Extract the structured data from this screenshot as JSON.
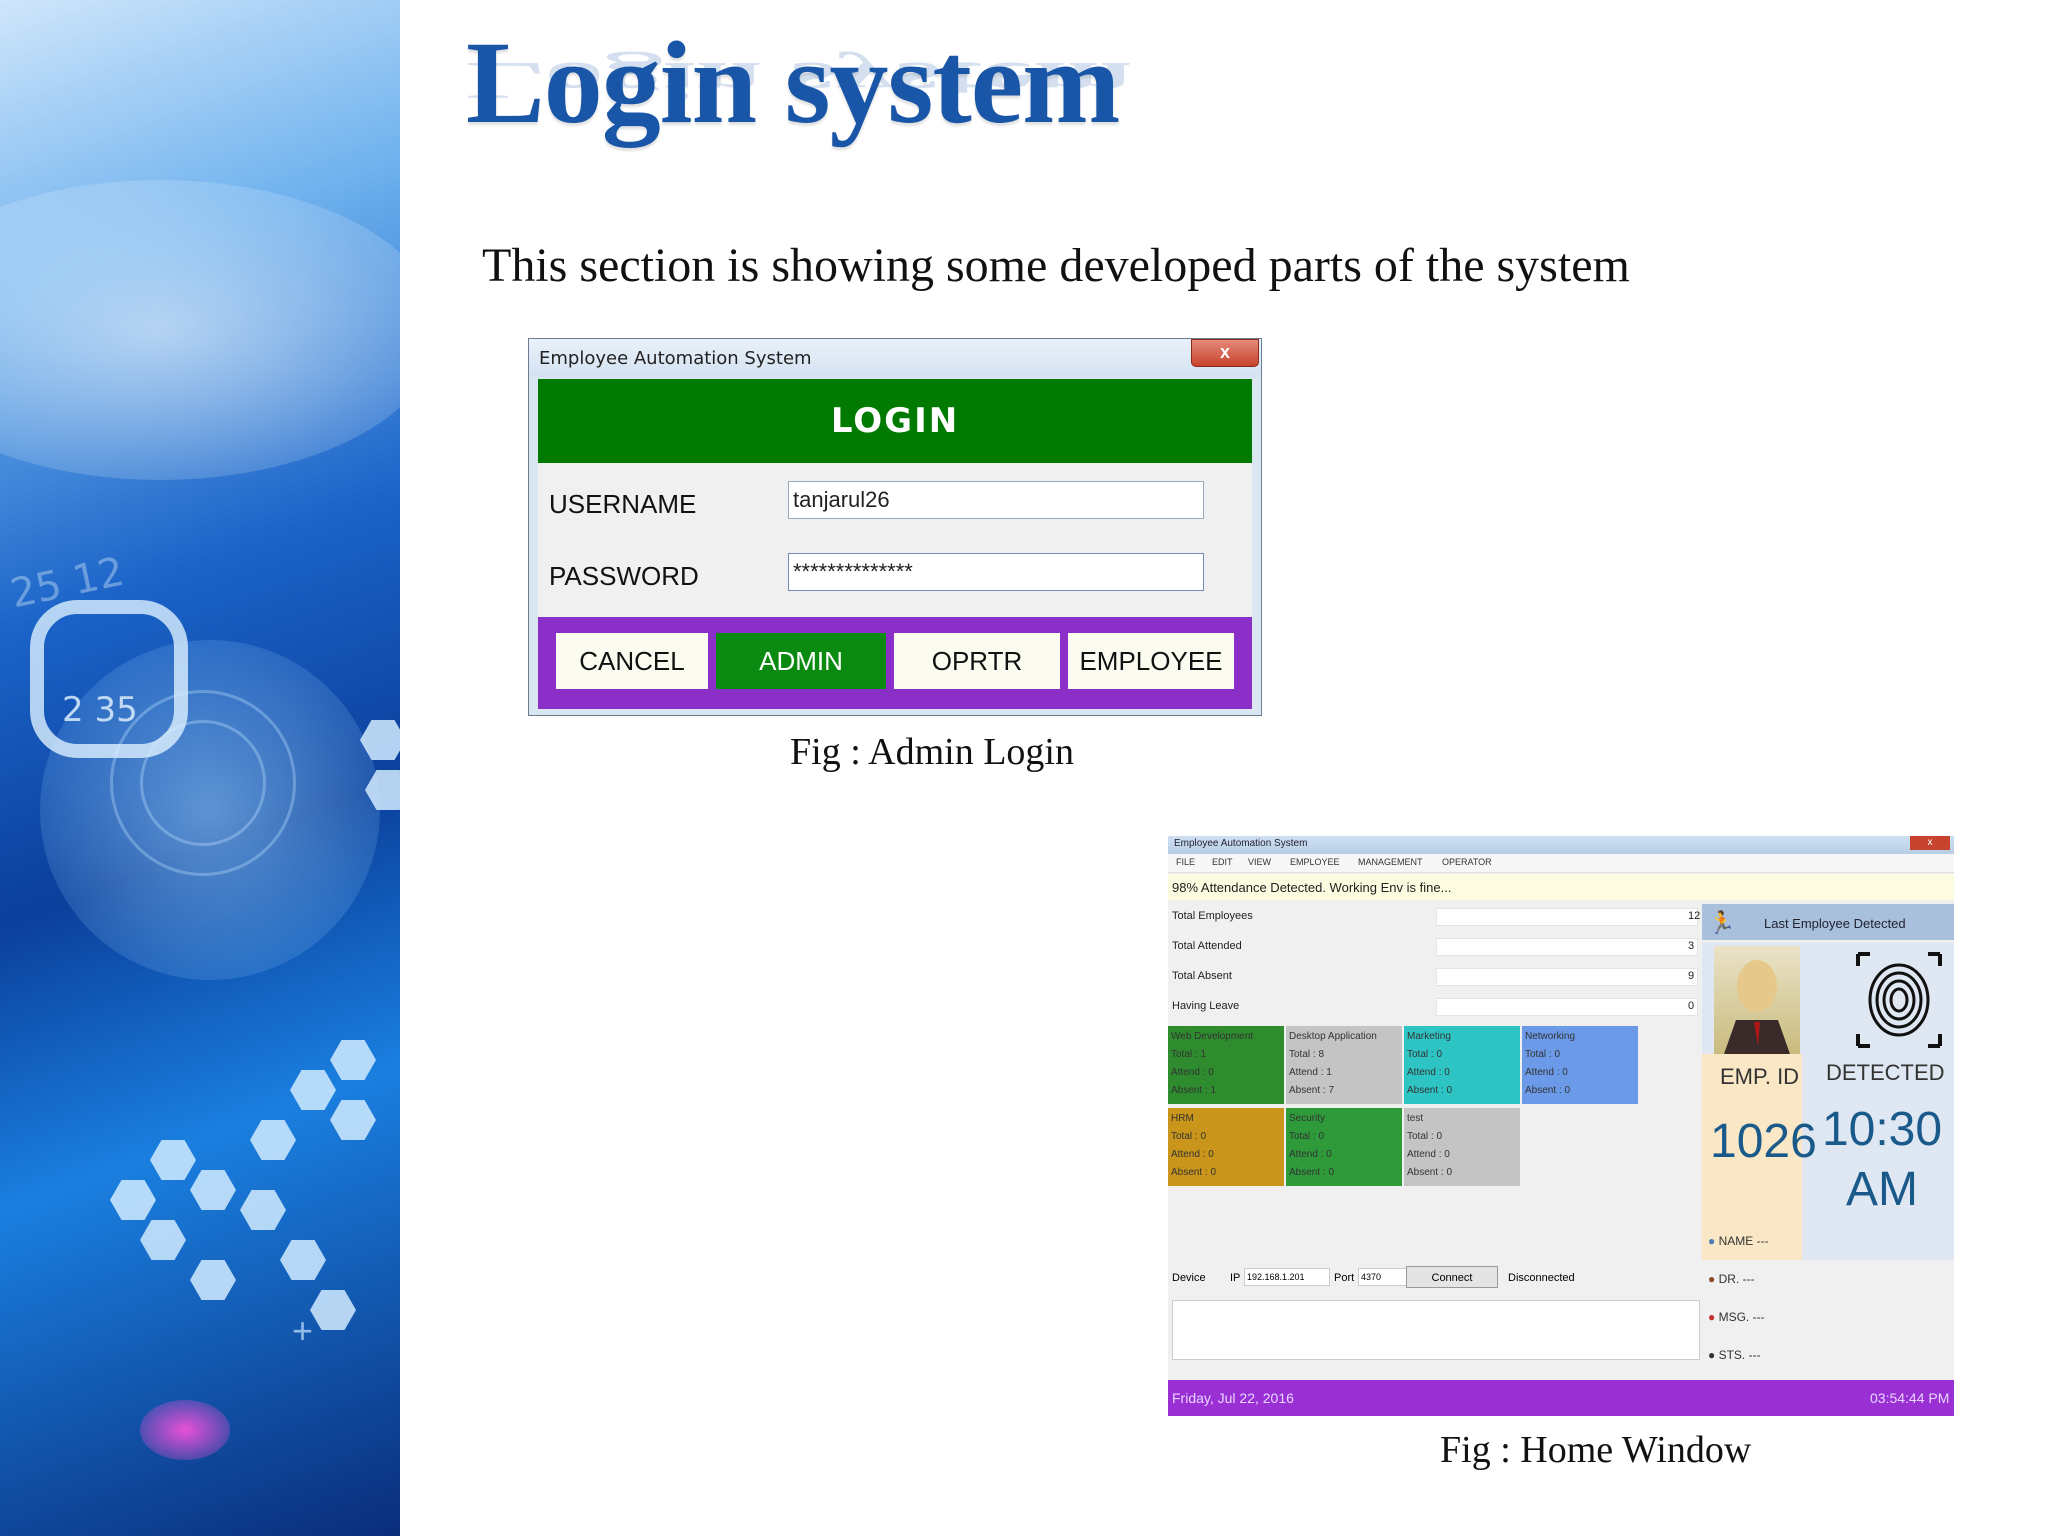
{
  "slide": {
    "title": "Login system",
    "subtitle": "This section is showing some developed parts of the system"
  },
  "left_panel": {
    "number_a": "2 35",
    "number_b": "25 12"
  },
  "login": {
    "window_title": "Employee Automation System",
    "close_label": "x",
    "header": "LOGIN",
    "username_label": "USERNAME",
    "username_value": "tanjarul26",
    "password_label": "PASSWORD",
    "password_value": "**************",
    "buttons": {
      "cancel": "CANCEL",
      "admin": "ADMIN",
      "operator": "OPRTR",
      "employee": "EMPLOYEE"
    },
    "colors": {
      "header": "#007a00",
      "button_bar": "#8b2fc9",
      "admin_button": "#0a8a10"
    },
    "caption": "Fig : Admin Login"
  },
  "home": {
    "caption": "Fig : Home Window",
    "window_title": "Employee Automation System",
    "menu": [
      "FILE",
      "EDIT",
      "VIEW",
      "EMPLOYEE",
      "MANAGEMENT",
      "OPERATOR"
    ],
    "status_text": "98% Attendance Detected. Working Env is fine...",
    "stats": [
      {
        "label": "Total Employees",
        "value": "12"
      },
      {
        "label": "Total Attended",
        "value": "3"
      },
      {
        "label": "Total Absent",
        "value": "9"
      },
      {
        "label": "Having Leave",
        "value": "0"
      }
    ],
    "departments": [
      {
        "name": "Web Development",
        "total": "Total   : 1",
        "attend": "Attend  : 0",
        "absent": "Absent  : 1",
        "color": "#2e8b2e"
      },
      {
        "name": "Desktop Application",
        "total": "Total   : 8",
        "attend": "Attend  : 1",
        "absent": "Absent  : 7",
        "color": "#c4c4c4"
      },
      {
        "name": "Marketing",
        "total": "Total   : 0",
        "attend": "Attend  : 0",
        "absent": "Absent  : 0",
        "color": "#2ec4c4"
      },
      {
        "name": "Networking",
        "total": "Total   : 0",
        "attend": "Attend  : 0",
        "absent": "Absent  : 0",
        "color": "#6a9ae8"
      },
      {
        "name": "HRM",
        "total": "Total   : 0",
        "attend": "Attend  : 0",
        "absent": "Absent  : 0",
        "color": "#c9951a"
      },
      {
        "name": "Security",
        "total": "Total   : 0",
        "attend": "Attend  : 0",
        "absent": "Absent  : 0",
        "color": "#2e9a3a"
      },
      {
        "name": "test",
        "total": "Total   : 0",
        "attend": "Attend  : 0",
        "absent": "Absent  : 0",
        "color": "#c4c4c4"
      }
    ],
    "last_employee_title": "Last Employee Detected",
    "emp_id_label": "EMP. ID",
    "emp_id_value": "1026",
    "detected_label": "DETECTED",
    "detected_time": "10:30 AM",
    "info": [
      {
        "label": "NAME",
        "value": "---"
      },
      {
        "label": "DR.",
        "value": "---"
      },
      {
        "label": "MSG.",
        "value": "---"
      },
      {
        "label": "STS.",
        "value": "---"
      }
    ],
    "device": {
      "label": "Device",
      "ip_label": "IP",
      "ip_value": "192.168.1.201",
      "port_label": "Port",
      "port_value": "4370",
      "connect_label": "Connect",
      "status": "Disconnected"
    },
    "footer_date": "Friday, Jul 22, 2016",
    "footer_time": "03:54:44 PM",
    "colors": {
      "footer": "#9a2fd4",
      "status_bar": "#fdfbe0"
    }
  }
}
